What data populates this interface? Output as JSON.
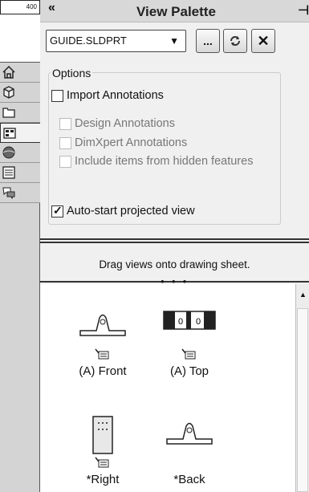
{
  "ruler": {
    "value": "400"
  },
  "side_tabs": [
    {
      "name": "home-tab",
      "icon": "home-icon"
    },
    {
      "name": "parts-tab",
      "icon": "cube-icon"
    },
    {
      "name": "file-explorer-tab",
      "icon": "folder-icon"
    },
    {
      "name": "view-palette-tab",
      "icon": "view-palette-icon"
    },
    {
      "name": "appearances-tab",
      "icon": "sphere-icon"
    },
    {
      "name": "custom-properties-tab",
      "icon": "list-icon"
    },
    {
      "name": "forum-tab",
      "icon": "chat-icon"
    }
  ],
  "palette": {
    "collapse_label": "«",
    "title": "View Palette",
    "pin_label": "⊣",
    "file_value": "GUIDE.SLDPRT",
    "browse_label": "...",
    "refresh_icon": "refresh-icon",
    "clear_icon": "close-icon"
  },
  "options": {
    "legend": "Options",
    "import_annotations": {
      "label": "Import Annotations",
      "checked": false
    },
    "design_annotations": {
      "label": "Design Annotations",
      "checked": false,
      "disabled": true
    },
    "dimxpert_annotations": {
      "label": "DimXpert Annotations",
      "checked": false,
      "disabled": true
    },
    "hidden_features": {
      "label": "Include items from hidden features",
      "checked": false,
      "disabled": true
    },
    "auto_start": {
      "label": "Auto-start projected view",
      "checked": true
    }
  },
  "drag_hint": "Drag views onto drawing sheet.",
  "views": [
    {
      "label": "(A) Front",
      "shape": "front-view"
    },
    {
      "label": "(A) Top",
      "shape": "top-view"
    },
    {
      "label": "*Right",
      "shape": "right-view"
    },
    {
      "label": "*Back",
      "shape": "back-view"
    }
  ]
}
